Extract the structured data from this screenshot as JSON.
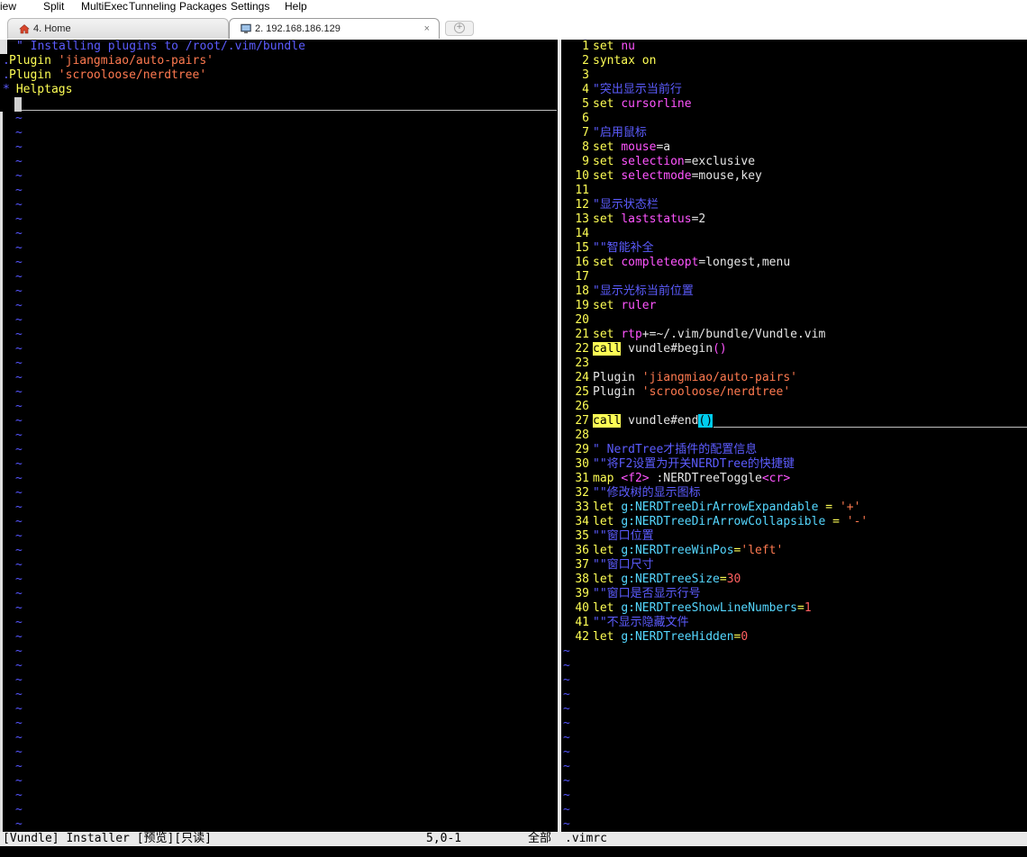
{
  "menu": [
    "iew",
    "Split",
    "MultiExec",
    "Tunneling",
    "Packages",
    "Settings",
    "Help"
  ],
  "tabs": [
    {
      "label": "4. Home",
      "icon": "home-icon"
    },
    {
      "label": "2. 192.168.186.129",
      "icon": "terminal-icon",
      "close": "×"
    }
  ],
  "left_pane": {
    "lines": [
      {
        "prefix": "",
        "text": "\" Installing plugins to /root/.vim/bundle"
      },
      {
        "prefix": ".",
        "text": " Plugin 'jiangmiao/auto-pairs'"
      },
      {
        "prefix": ".",
        "text": " Plugin 'scrooloose/nerdtree'"
      },
      {
        "prefix": "*",
        "text": " Helptags"
      }
    ],
    "tilde": "~"
  },
  "right_pane": {
    "lines": [
      {
        "n": "1",
        "segs": [
          {
            "t": "set ",
            "c": "y"
          },
          {
            "t": "nu",
            "c": "mag"
          }
        ]
      },
      {
        "n": "2",
        "segs": [
          {
            "t": "syntax ",
            "c": "y"
          },
          {
            "t": "on",
            "c": "y"
          }
        ]
      },
      {
        "n": "3",
        "segs": []
      },
      {
        "n": "4",
        "segs": [
          {
            "t": "\"突出显示当前行",
            "c": "blue"
          }
        ]
      },
      {
        "n": "5",
        "segs": [
          {
            "t": "set ",
            "c": "y"
          },
          {
            "t": "cursorline",
            "c": "mag"
          }
        ]
      },
      {
        "n": "6",
        "segs": []
      },
      {
        "n": "7",
        "segs": [
          {
            "t": "\"启用鼠标",
            "c": "blue"
          }
        ]
      },
      {
        "n": "8",
        "segs": [
          {
            "t": "set ",
            "c": "y"
          },
          {
            "t": "mouse",
            "c": "mag"
          },
          {
            "t": "=a",
            "c": "w"
          }
        ]
      },
      {
        "n": "9",
        "segs": [
          {
            "t": "set ",
            "c": "y"
          },
          {
            "t": "selection",
            "c": "mag"
          },
          {
            "t": "=exclusive",
            "c": "w"
          }
        ]
      },
      {
        "n": "10",
        "segs": [
          {
            "t": "set ",
            "c": "y"
          },
          {
            "t": "selectmode",
            "c": "mag"
          },
          {
            "t": "=mouse,key",
            "c": "w"
          }
        ]
      },
      {
        "n": "11",
        "segs": []
      },
      {
        "n": "12",
        "segs": [
          {
            "t": "\"显示状态栏",
            "c": "blue"
          }
        ]
      },
      {
        "n": "13",
        "segs": [
          {
            "t": "set ",
            "c": "y"
          },
          {
            "t": "laststatus",
            "c": "mag"
          },
          {
            "t": "=2",
            "c": "w"
          }
        ]
      },
      {
        "n": "14",
        "segs": []
      },
      {
        "n": "15",
        "segs": [
          {
            "t": "\"\"智能补全",
            "c": "blue"
          }
        ]
      },
      {
        "n": "16",
        "segs": [
          {
            "t": "set ",
            "c": "y"
          },
          {
            "t": "completeopt",
            "c": "mag"
          },
          {
            "t": "=longest,menu",
            "c": "w"
          }
        ]
      },
      {
        "n": "17",
        "segs": []
      },
      {
        "n": "18",
        "segs": [
          {
            "t": "\"显示光标当前位置",
            "c": "blue"
          }
        ]
      },
      {
        "n": "19",
        "segs": [
          {
            "t": "set ",
            "c": "y"
          },
          {
            "t": "ruler",
            "c": "mag"
          }
        ]
      },
      {
        "n": "20",
        "segs": []
      },
      {
        "n": "21",
        "segs": [
          {
            "t": "set ",
            "c": "y"
          },
          {
            "t": "rtp",
            "c": "mag"
          },
          {
            "t": "+=~/.vim/bundle/Vundle.vim",
            "c": "w"
          }
        ]
      },
      {
        "n": "22",
        "segs": [
          {
            "t": "call",
            "c": "hl"
          },
          {
            "t": " vundle#begin",
            "c": "w"
          },
          {
            "t": "()",
            "c": "mag"
          }
        ]
      },
      {
        "n": "23",
        "segs": []
      },
      {
        "n": "24",
        "segs": [
          {
            "t": "Plugin ",
            "c": "w"
          },
          {
            "t": "'jiangmiao/auto-pairs'",
            "c": "orn"
          }
        ]
      },
      {
        "n": "25",
        "segs": [
          {
            "t": "Plugin ",
            "c": "w"
          },
          {
            "t": "'scrooloose/nerdtree'",
            "c": "orn"
          }
        ]
      },
      {
        "n": "26",
        "segs": []
      },
      {
        "n": "27",
        "segs": [
          {
            "t": "call",
            "c": "hl"
          },
          {
            "t": " vundle#end",
            "c": "w"
          },
          {
            "t": "()",
            "c": "pb"
          }
        ]
      },
      {
        "n": "28",
        "segs": []
      },
      {
        "n": "29",
        "segs": [
          {
            "t": "\" NerdTree才插件的配置信息",
            "c": "blue"
          }
        ]
      },
      {
        "n": "30",
        "segs": [
          {
            "t": "\"\"将F2设置为开关NERDTree的快捷键",
            "c": "blue"
          }
        ]
      },
      {
        "n": "31",
        "segs": [
          {
            "t": "map ",
            "c": "y"
          },
          {
            "t": "<f2>",
            "c": "mag"
          },
          {
            "t": " :NERDTreeToggle",
            "c": "w"
          },
          {
            "t": "<cr>",
            "c": "mag"
          }
        ]
      },
      {
        "n": "32",
        "segs": [
          {
            "t": "\"\"修改树的显示图标",
            "c": "blue"
          }
        ]
      },
      {
        "n": "33",
        "segs": [
          {
            "t": "let ",
            "c": "y"
          },
          {
            "t": "g:NERDTreeDirArrowExpandable",
            "c": "cyan"
          },
          {
            "t": " = ",
            "c": "y"
          },
          {
            "t": "'+'",
            "c": "orn"
          }
        ]
      },
      {
        "n": "34",
        "segs": [
          {
            "t": "let ",
            "c": "y"
          },
          {
            "t": "g:NERDTreeDirArrowCollapsible",
            "c": "cyan"
          },
          {
            "t": " = ",
            "c": "y"
          },
          {
            "t": "'-'",
            "c": "orn"
          }
        ]
      },
      {
        "n": "35",
        "segs": [
          {
            "t": "\"\"窗口位置",
            "c": "blue"
          }
        ]
      },
      {
        "n": "36",
        "segs": [
          {
            "t": "let ",
            "c": "y"
          },
          {
            "t": "g:NERDTreeWinPos",
            "c": "cyan"
          },
          {
            "t": "=",
            "c": "y"
          },
          {
            "t": "'left'",
            "c": "orn"
          }
        ]
      },
      {
        "n": "37",
        "segs": [
          {
            "t": "\"\"窗口尺寸",
            "c": "blue"
          }
        ]
      },
      {
        "n": "38",
        "segs": [
          {
            "t": "let ",
            "c": "y"
          },
          {
            "t": "g:NERDTreeSize",
            "c": "cyan"
          },
          {
            "t": "=",
            "c": "y"
          },
          {
            "t": "30",
            "c": "red"
          }
        ]
      },
      {
        "n": "39",
        "segs": [
          {
            "t": "\"\"窗口是否显示行号",
            "c": "blue"
          }
        ]
      },
      {
        "n": "40",
        "segs": [
          {
            "t": "let ",
            "c": "y"
          },
          {
            "t": "g:NERDTreeShowLineNumbers",
            "c": "cyan"
          },
          {
            "t": "=",
            "c": "y"
          },
          {
            "t": "1",
            "c": "red"
          }
        ]
      },
      {
        "n": "41",
        "segs": [
          {
            "t": "\"\"不显示隐藏文件",
            "c": "blue"
          }
        ]
      },
      {
        "n": "42",
        "segs": [
          {
            "t": "let ",
            "c": "y"
          },
          {
            "t": "g:NERDTreeHidden",
            "c": "cyan"
          },
          {
            "t": "=",
            "c": "y"
          },
          {
            "t": "0",
            "c": "red"
          }
        ]
      }
    ],
    "tilde": "~"
  },
  "status": {
    "left": "[Vundle] Installer [预览][只读]",
    "position": "5,0-1",
    "scroll": "全部",
    "right_file": ".vimrc"
  },
  "colors": {
    "bg": "#000000",
    "line_number": "#ffff55",
    "keyword": "#ffff55",
    "option": "#ff55ff",
    "comment": "#5c5cff",
    "string": "#ff7a50",
    "variable": "#55d7ff",
    "tilde": "#5555ff"
  }
}
